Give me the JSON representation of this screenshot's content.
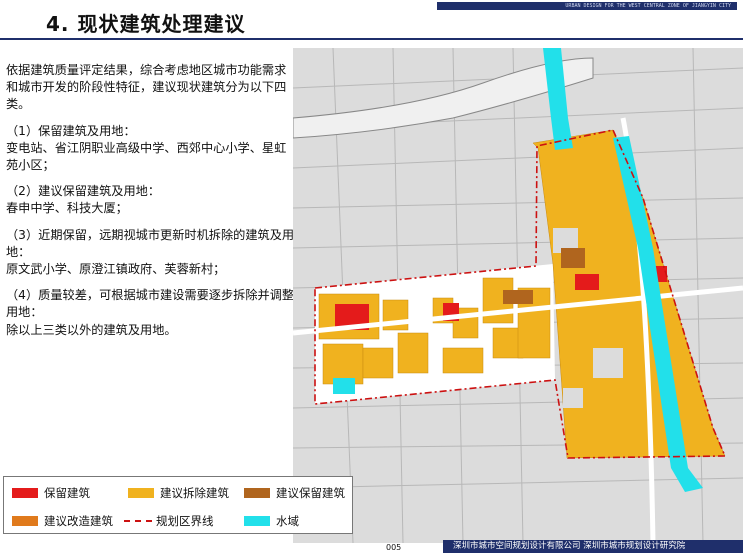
{
  "header": {
    "title": "4. 现状建筑处理建议",
    "tag": "URBAN DESIGN FOR THE WEST CENTRAL ZONE OF JIANGYIN CITY"
  },
  "content": {
    "intro": "依据建筑质量评定结果，综合考虑地区城市功能需求和城市开发的阶段性特征，建议现状建筑分为以下四类。",
    "items": [
      {
        "heading": "（1）保留建筑及用地：",
        "detail": "变电站、省江阴职业高级中学、西郊中心小学、星虹苑小区；"
      },
      {
        "heading": "（2）建议保留建筑及用地：",
        "detail": "春申中学、科技大厦；"
      },
      {
        "heading": "（3）近期保留，远期视城市更新时机拆除的建筑及用地：",
        "detail": "原文武小学、原澄江镇政府、芙蓉新村；"
      },
      {
        "heading": "（4）质量较差，可根据城市建设需要逐步拆除并调整用地：",
        "detail": "除以上三类以外的建筑及用地。"
      }
    ]
  },
  "legend": {
    "items": [
      {
        "label": "保留建筑",
        "color": "#e41b1b",
        "kind": "fill"
      },
      {
        "label": "建议拆除建筑",
        "color": "#f0b21f",
        "kind": "fill"
      },
      {
        "label": "建议保留建筑",
        "color": "#b0651e",
        "kind": "fill"
      },
      {
        "label": "建议改造建筑",
        "color": "#e07a1c",
        "kind": "fill"
      },
      {
        "label": "规划区界线",
        "color": "#cc1111",
        "kind": "dash"
      },
      {
        "label": "水域",
        "color": "#22e0ea",
        "kind": "fill"
      }
    ]
  },
  "footer": {
    "page": "005",
    "org": "深圳市城市空间规划设计有限公司  深圳市城市规划设计研究院"
  },
  "colors": {
    "brand_navy": "#1f2f6b",
    "map_background": "#d9d9d9",
    "demolish": "#f0b21f",
    "retain": "#e41b1b",
    "suggest_retain": "#b0651e",
    "water": "#22e0ea",
    "boundary": "#cc1111"
  }
}
